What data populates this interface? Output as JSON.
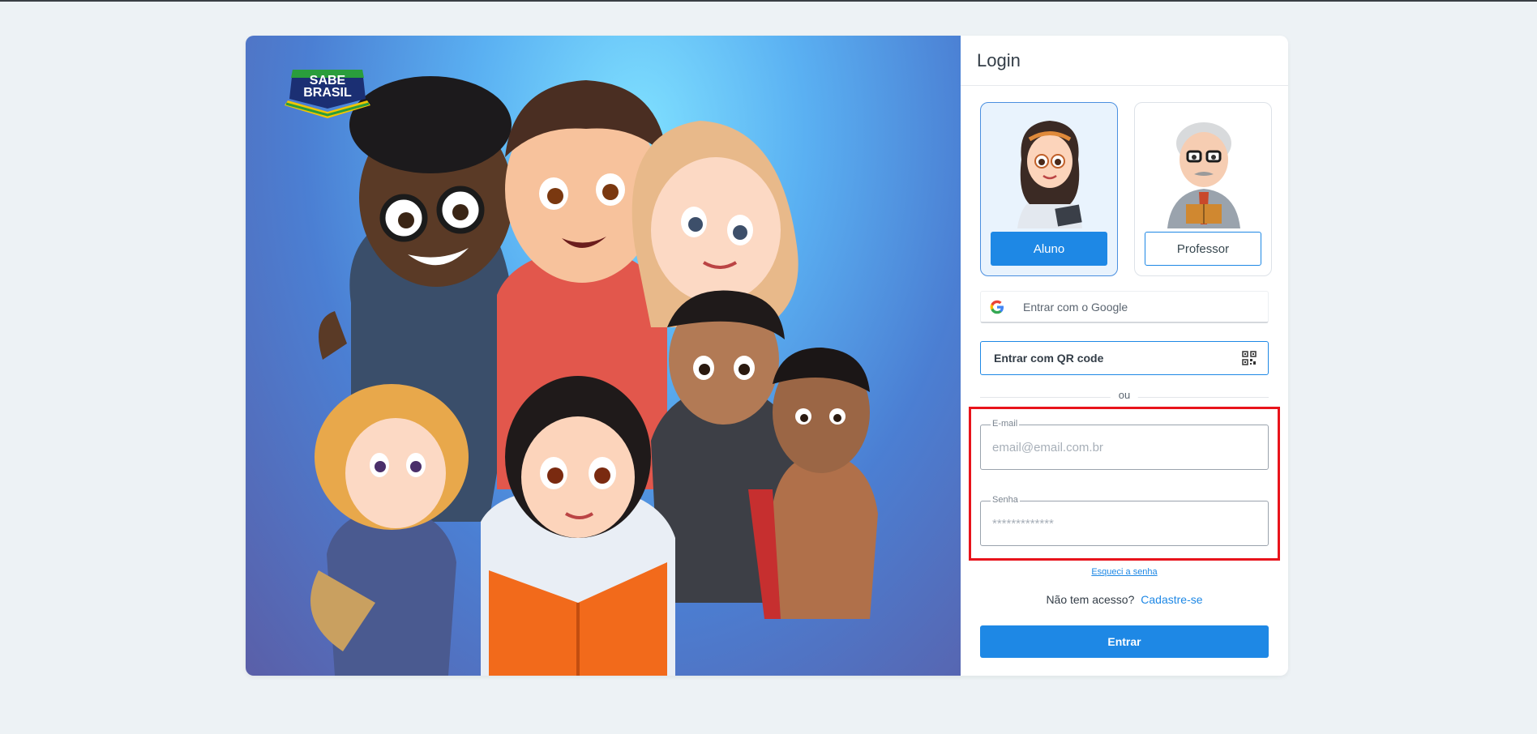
{
  "hero": {
    "logo_line1": "SABE",
    "logo_line2": "BRASIL"
  },
  "login": {
    "title": "Login",
    "roles": [
      {
        "label": "Aluno",
        "selected": true
      },
      {
        "label": "Professor",
        "selected": false
      }
    ],
    "google_label": "Entrar com o Google",
    "qr_label": "Entrar com QR code",
    "divider": "ou",
    "email": {
      "label": "E-mail",
      "placeholder": "email@email.com.br",
      "value": ""
    },
    "password": {
      "label": "Senha",
      "placeholder": "*************",
      "value": ""
    },
    "forgot": "Esqueci a senha",
    "signup_prompt": "Não tem acesso?",
    "signup_link": "Cadastre-se",
    "submit": "Entrar"
  },
  "colors": {
    "accent": "#1e88e5",
    "highlight": "#e8131b",
    "background": "#edf2f5"
  }
}
